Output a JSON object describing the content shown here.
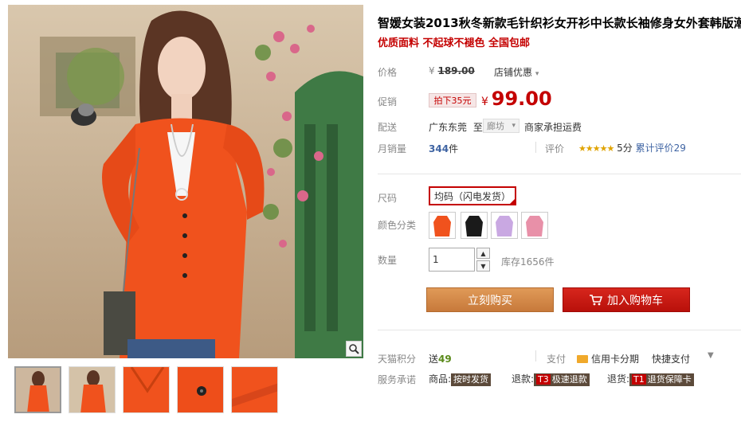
{
  "product": {
    "title": "智媛女装2013秋冬新款毛针织衫女开衫中长款长袖修身女外套韩版潮",
    "subtitle": "优质面料 不起球不褪色 全国包邮"
  },
  "price": {
    "label": "价格",
    "yen": "¥",
    "original": "189.00",
    "store_promo": "店铺优惠"
  },
  "promo": {
    "label": "促销",
    "badge": "拍下35元",
    "yen": "¥",
    "price": "99.00"
  },
  "delivery": {
    "label": "配送",
    "from": "广东东莞",
    "to_word": "至",
    "destination": "廊坊",
    "shipping": "商家承担运费"
  },
  "sales": {
    "label": "月销量",
    "count": "344",
    "unit": "件",
    "rating_label": "评价",
    "stars": "★★★★★",
    "score": "5分",
    "review_link": "累计评价29"
  },
  "options": {
    "size_label": "尺码",
    "size_value": "均码（闪电发货）",
    "color_label": "颜色分类",
    "colors": [
      {
        "name": "orange",
        "hex": "#f0521d"
      },
      {
        "name": "black",
        "hex": "#1a1a1a"
      },
      {
        "name": "lilac",
        "hex": "#c9a8e2"
      },
      {
        "name": "pink",
        "hex": "#e890a8"
      }
    ]
  },
  "quantity": {
    "label": "数量",
    "value": "1",
    "stock": "库存1656件"
  },
  "buttons": {
    "buy_now": "立刻购买",
    "add_cart": "加入购物车"
  },
  "extras": {
    "points_label": "天猫积分",
    "points_prefix": "送",
    "points_value": "49",
    "pay_label": "支付",
    "credit_card": "信用卡分期",
    "quick_pay": "快捷支付",
    "service_label": "服务承诺",
    "svc_goods": "商品:",
    "svc_goods_tag": "按时发货",
    "svc_refund": "退款:",
    "svc_refund_code": "T3",
    "svc_refund_tag": "极速退款",
    "svc_return": "退货:",
    "svc_return_code": "T1",
    "svc_return_tag": "退货保障卡"
  },
  "colors": {
    "accent_red": "#c40000",
    "link_blue": "#3f64a3",
    "buy_orange": "#d28c48",
    "cart_red": "#c8140d",
    "garment_orange": "#f0521d"
  }
}
